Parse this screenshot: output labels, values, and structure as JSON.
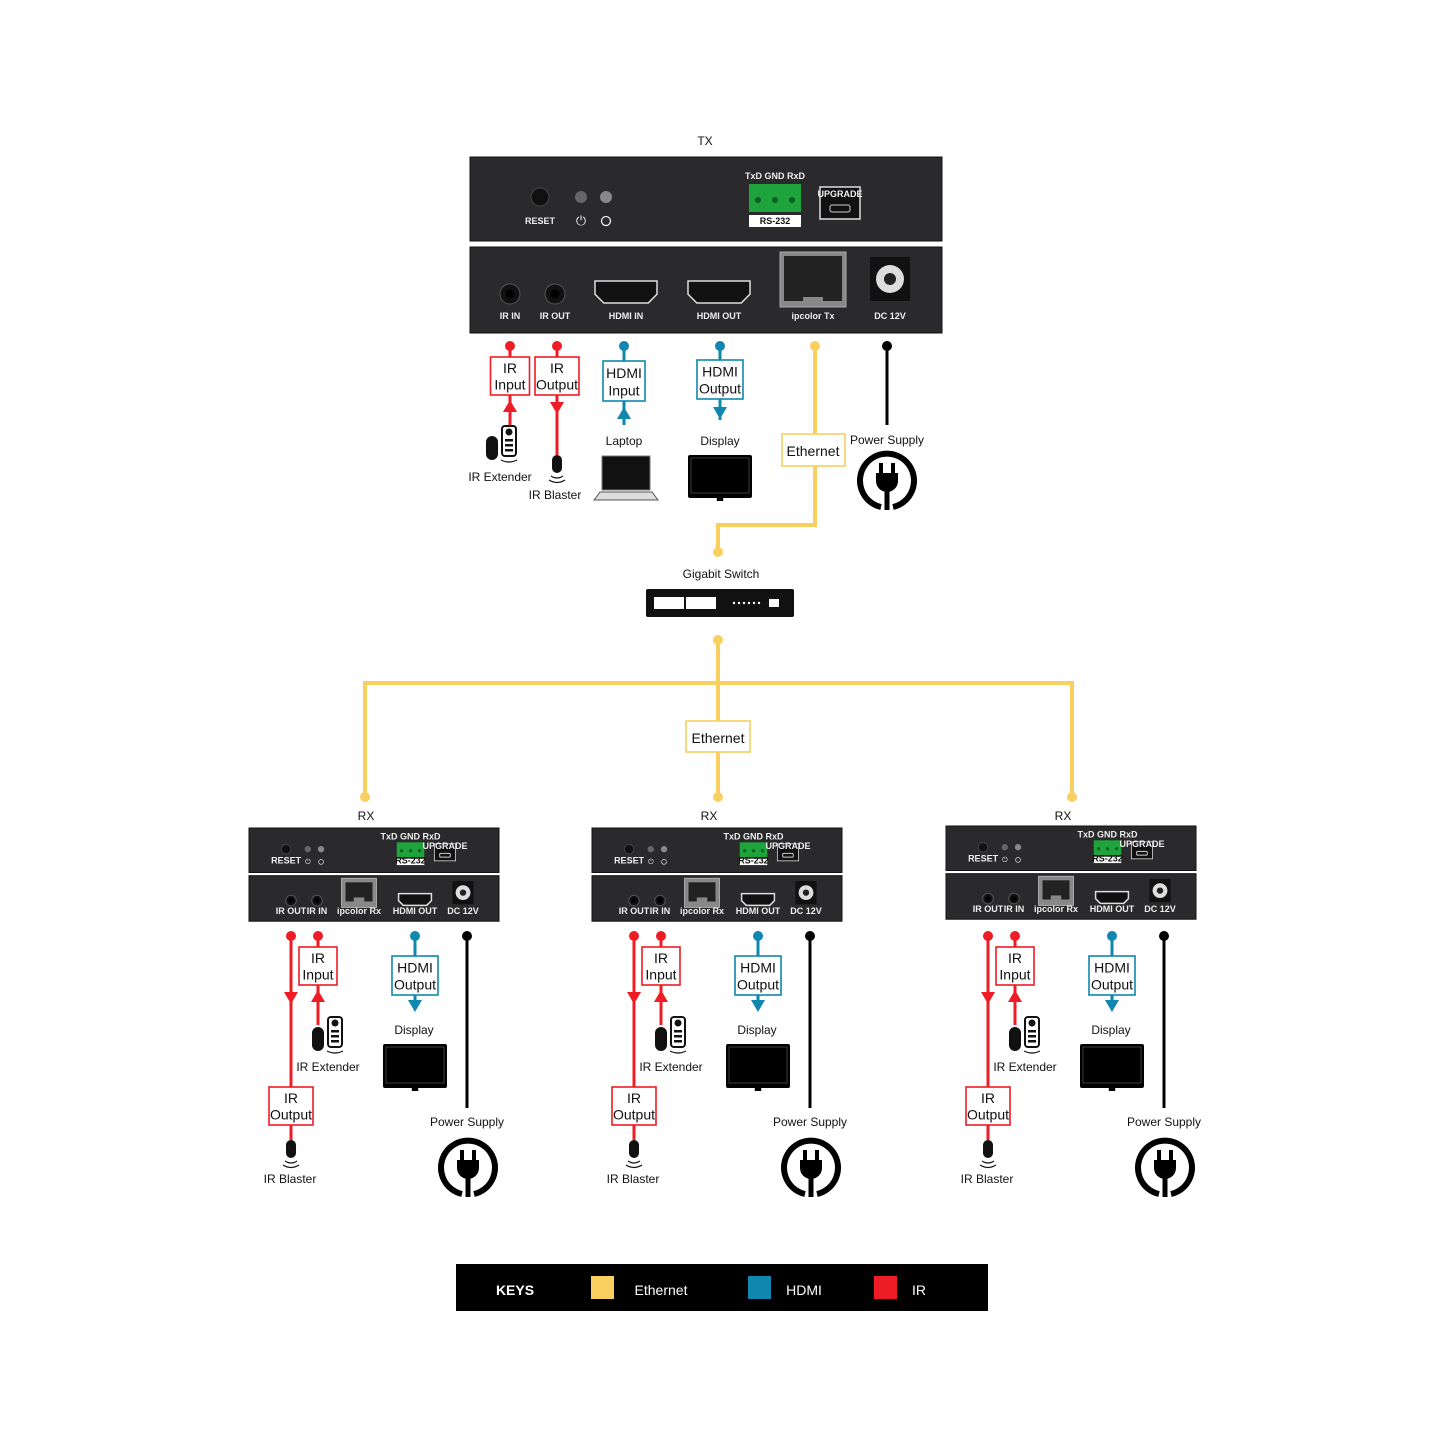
{
  "colors": {
    "ethernet": "#f9cf5f",
    "hdmi": "#0f87ae",
    "ir": "#ee1c24",
    "power": "#000000",
    "device": "#2a2a2c"
  },
  "tx": {
    "title": "TX",
    "front": {
      "reset": "RESET",
      "rs232_pins": "TxD GND RxD",
      "rs232": "RS-232",
      "upgrade": "UPGRADE"
    },
    "rear": {
      "ir_in": "IR IN",
      "ir_out": "IR OUT",
      "hdmi_in": "HDMI IN",
      "hdmi_out": "HDMI OUT",
      "lan": "ipcolor  Tx",
      "dc": "DC 12V"
    },
    "connections": {
      "ir_input": {
        "line1": "IR",
        "line2": "Input",
        "device": "IR Extender"
      },
      "ir_output": {
        "line1": "IR",
        "line2": "Output",
        "device": "IR Blaster"
      },
      "hdmi_input": {
        "line1": "HDMI",
        "line2": "Input",
        "device": "Laptop"
      },
      "hdmi_output": {
        "line1": "HDMI",
        "line2": "Output",
        "device": "Display"
      },
      "ethernet": {
        "label": "Ethernet"
      },
      "power": {
        "device": "Power Supply"
      }
    }
  },
  "switch": {
    "label": "Gigabit Switch"
  },
  "trunk": {
    "label": "Ethernet"
  },
  "rx": [
    {
      "title": "RX"
    },
    {
      "title": "RX"
    },
    {
      "title": "RX"
    }
  ],
  "rx_common": {
    "front": {
      "reset": "RESET",
      "rs232_pins": "TxD GND RxD",
      "rs232": "RS-232",
      "upgrade": "UPGRADE"
    },
    "rear": {
      "ir_out": "IR OUT",
      "ir_in": "IR IN",
      "lan": "ipcolor Rx",
      "hdmi_out": "HDMI OUT",
      "dc": "DC 12V"
    },
    "connections": {
      "ir_input": {
        "line1": "IR",
        "line2": "Input",
        "device": "IR Extender"
      },
      "ir_output": {
        "line1": "IR",
        "line2": "Output",
        "device": "IR Blaster"
      },
      "hdmi_output": {
        "line1": "HDMI",
        "line2": "Output",
        "device": "Display"
      },
      "power": {
        "device": "Power Supply"
      }
    }
  },
  "keys": {
    "title": "KEYS",
    "items": [
      {
        "label": "Ethernet",
        "color": "#f9cf5f"
      },
      {
        "label": "HDMI",
        "color": "#0f87ae"
      },
      {
        "label": "IR",
        "color": "#ee1c24"
      }
    ]
  }
}
